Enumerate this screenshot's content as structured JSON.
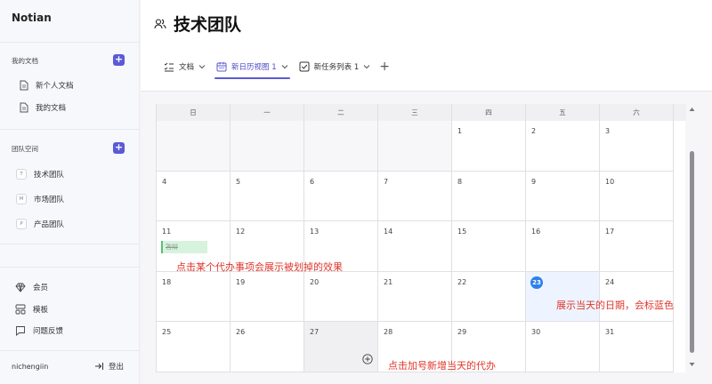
{
  "app": {
    "brand": "Notian"
  },
  "sidebar": {
    "my_docs_title": "我的文档",
    "docs": [
      {
        "label": "新个人文档",
        "icon": "document-icon"
      },
      {
        "label": "我的文档",
        "icon": "document-icon"
      }
    ],
    "team_space_title": "团队空间",
    "teams": [
      {
        "badge": "T",
        "label": "技术团队"
      },
      {
        "badge": "M",
        "label": "市场团队"
      },
      {
        "badge": "P",
        "label": "产品团队"
      }
    ],
    "bottom": [
      {
        "label": "会员",
        "icon": "diamond-icon"
      },
      {
        "label": "模板",
        "icon": "template-icon"
      },
      {
        "label": "问题反馈",
        "icon": "feedback-icon"
      }
    ],
    "user_name": "nichengiin",
    "logout_label": "登出"
  },
  "page": {
    "title": "技术团队",
    "title_icon": "team-icon"
  },
  "views": {
    "tabs": [
      {
        "label": "文档",
        "icon": "checklist-icon",
        "active": false
      },
      {
        "label": "新日历视图 1",
        "icon": "calendar-icon",
        "active": true
      },
      {
        "label": "新任务列表 1",
        "icon": "checkbox-icon",
        "active": false
      }
    ],
    "add_label": "+"
  },
  "calendar": {
    "weekdays": [
      "日",
      "一",
      "二",
      "三",
      "四",
      "五",
      "六"
    ],
    "weeks": [
      [
        "",
        "",
        "",
        "",
        "1",
        "2",
        "3"
      ],
      [
        "4",
        "5",
        "6",
        "7",
        "8",
        "9",
        "10"
      ],
      [
        "11",
        "12",
        "13",
        "14",
        "15",
        "16",
        "17"
      ],
      [
        "18",
        "19",
        "20",
        "21",
        "22",
        "23",
        "24"
      ],
      [
        "25",
        "26",
        "27",
        "28",
        "29",
        "30",
        "31"
      ]
    ],
    "today": "23",
    "completed_todo": {
      "day": "11",
      "text": "答辩"
    }
  },
  "annotations": {
    "strike": "点击某个代办事项会展示被划掉的效果",
    "today": "展示当天的日期，会标蓝色",
    "add": "点击加号新增当天的代办"
  },
  "colors": {
    "accent": "#5b5bd6",
    "today": "#2f80ed",
    "annotation": "#e0362b",
    "todo_bg": "#d7f3dd"
  }
}
